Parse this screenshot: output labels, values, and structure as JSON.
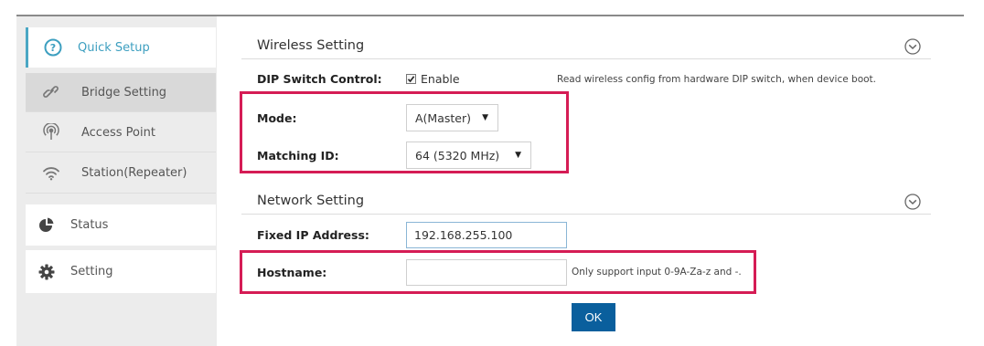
{
  "sidebar": {
    "quick_setup": "Quick Setup",
    "bridge_setting": "Bridge Setting",
    "access_point": "Access Point",
    "station_repeater": "Station(Repeater)",
    "status": "Status",
    "setting": "Setting"
  },
  "wireless": {
    "title": "Wireless Setting",
    "dip_label": "DIP Switch Control:",
    "dip_checked": true,
    "dip_enable_label": "Enable",
    "dip_hint": "Read wireless config from hardware DIP switch, when device boot.",
    "mode_label": "Mode:",
    "mode_value": "A(Master)",
    "matching_label": "Matching ID:",
    "matching_value": "64 (5320 MHz)"
  },
  "network": {
    "title": "Network Setting",
    "ip_label": "Fixed IP Address:",
    "ip_value": "192.168.255.100",
    "hostname_label": "Hostname:",
    "hostname_value": "",
    "hostname_hint": "Only support input 0-9A-Za-z and -."
  },
  "ok_label": "OK",
  "colors": {
    "accent": "#3d9fc0",
    "highlight_box": "#d51c55",
    "ok_button": "#0a5f9d"
  },
  "icons": {
    "quick_setup": "question-circle-icon",
    "bridge": "link-icon",
    "access_point": "broadcast-icon",
    "station": "wifi-icon",
    "status": "pie-chart-icon",
    "setting": "gear-icon",
    "collapse": "chevron-down-circle-icon"
  }
}
